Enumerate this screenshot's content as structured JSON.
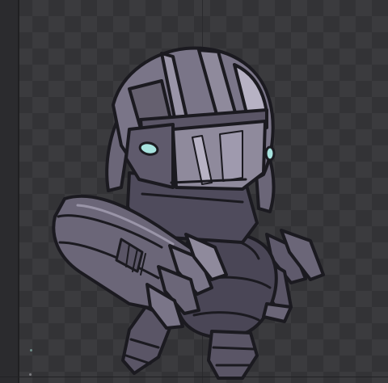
{
  "canvas": {
    "background": "#3b3b3e",
    "checker_alt": "#333336"
  },
  "character": {
    "palette": {
      "outline": "#1b1a20",
      "armor_light": "#8f8a9c",
      "armor_mid": "#6b6678",
      "armor_dark": "#4a4656",
      "highlight": "#b7b2c4",
      "eye_glow": "#a8e3df"
    }
  }
}
